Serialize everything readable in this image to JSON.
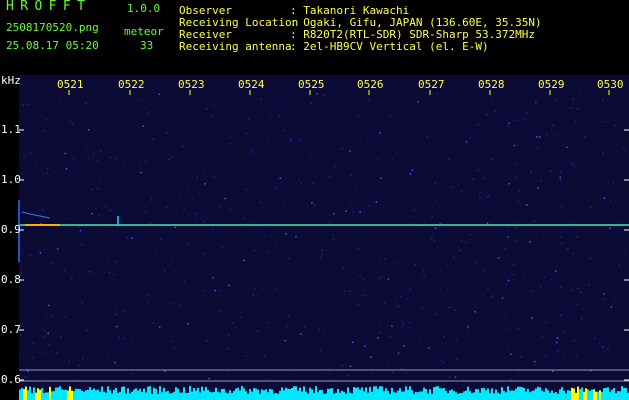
{
  "app": {
    "title": "HROFFT",
    "version": "1.0.0"
  },
  "file": {
    "name": "2508170520.png",
    "datetime": "25.08.17 05:20"
  },
  "meteor": {
    "label": "meteor",
    "count": "33"
  },
  "header": {
    "observer_key": "Observer",
    "observer_val": ": Takanori Kawachi",
    "location_key": "Receiving Location",
    "location_val": ": Ogaki, Gifu, JAPAN (136.60E, 35.35N)",
    "receiver_key": "Receiver",
    "receiver_val": ": R820T2(RTL-SDR) SDR-Sharp 53.372MHz",
    "antenna_key": "Receiving antenna",
    "antenna_val": ": 2el-HB9CV Vertical (el. E-W)"
  },
  "axis": {
    "unit": "kHz",
    "y_ticks": [
      "1.1",
      "1.0",
      "0.9",
      "0.8",
      "0.7",
      "0.6"
    ],
    "time_ticks": [
      "0521",
      "0522",
      "0523",
      "0524",
      "0525",
      "0526",
      "0527",
      "0528",
      "0529",
      "0530"
    ]
  },
  "colors": {
    "label_green": "#66ff33",
    "label_yellow": "#ffff44",
    "background": "#0b0b36",
    "signal_line": "#3fd0a0",
    "noise_bar": "#00e8ff"
  }
}
